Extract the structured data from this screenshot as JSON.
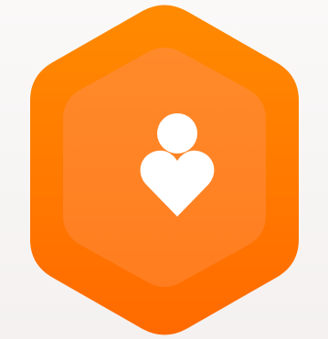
{
  "app": {
    "screen": "caregiver-badge-icon",
    "badge": {
      "shape": "rounded-hexagon",
      "icon": "person-heart-icon",
      "colors": {
        "outer_top": "#ff8a00",
        "outer_bottom": "#ff6a00",
        "inner": "#ff8a2a",
        "inner_bottom": "#ff7d1f",
        "symbol": "#ffffff",
        "background": "#f7f4f3"
      }
    }
  }
}
